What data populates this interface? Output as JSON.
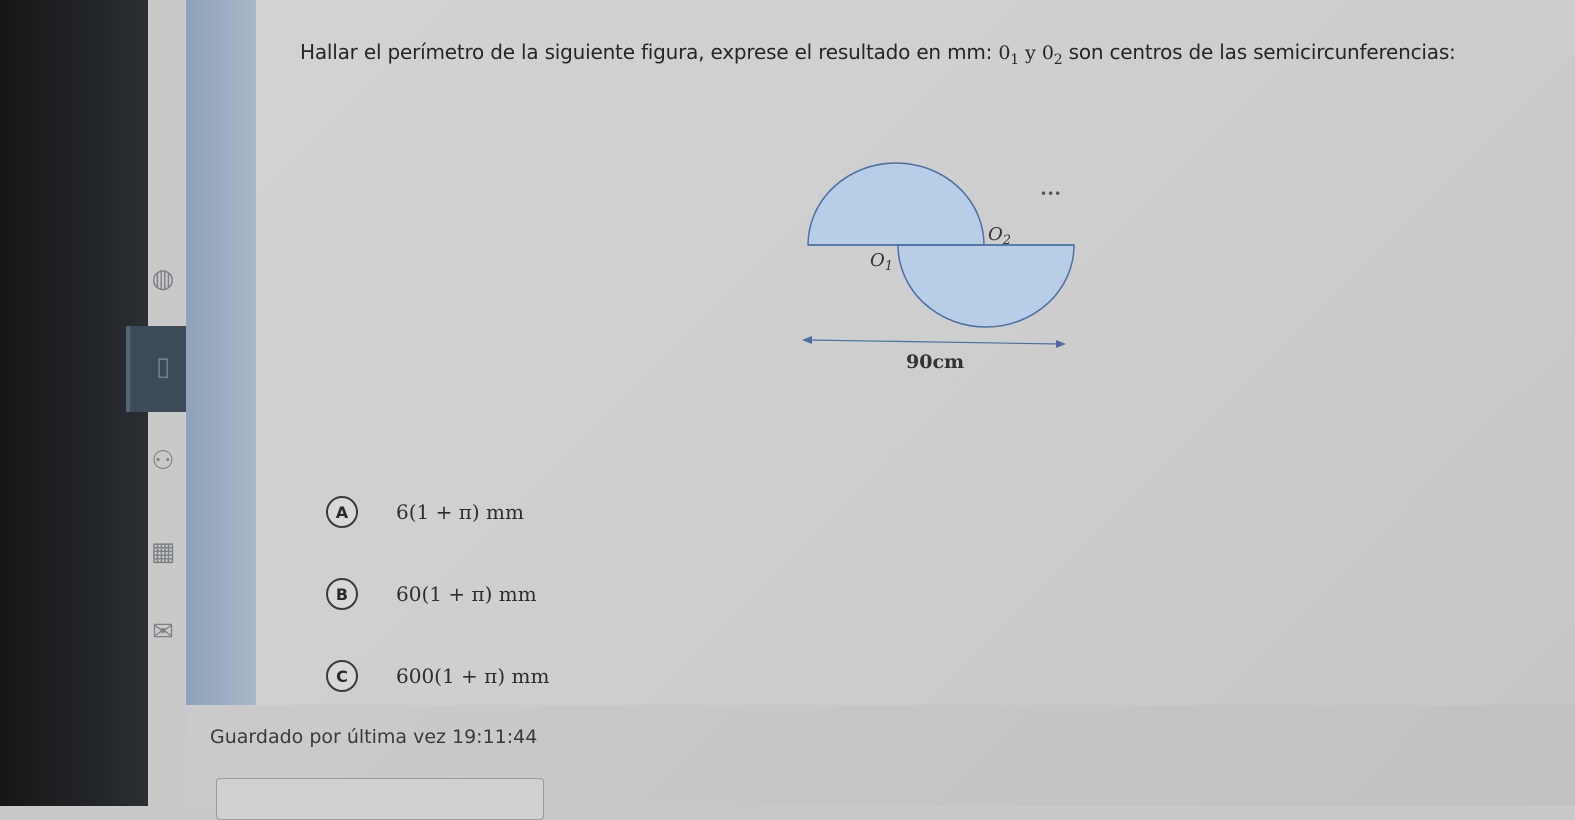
{
  "question": {
    "prefix": "Hallar el perímetro de la siguiente figura, exprese el resultado en mm:",
    "o1_base": "0",
    "o1_sub": "1",
    "conjunction": "y",
    "o2_base": "0",
    "o2_sub": "2",
    "suffix": "son centros de las semicircunferencias:"
  },
  "figure": {
    "label_o1": "O",
    "label_o1_sub": "1",
    "label_o2": "O",
    "label_o2_sub": "2",
    "dimension_label": "90cm",
    "more_menu": "•••",
    "fill_color": "#b8cde6",
    "stroke_color": "#4a6fa5"
  },
  "options": [
    {
      "letter": "A",
      "text": "6(1 + π) mm"
    },
    {
      "letter": "B",
      "text": "60(1 + π) mm"
    },
    {
      "letter": "C",
      "text": "600(1 + π) mm"
    }
  ],
  "status": {
    "saved_label": "Guardado por última vez",
    "saved_time": "19:11:44"
  }
}
